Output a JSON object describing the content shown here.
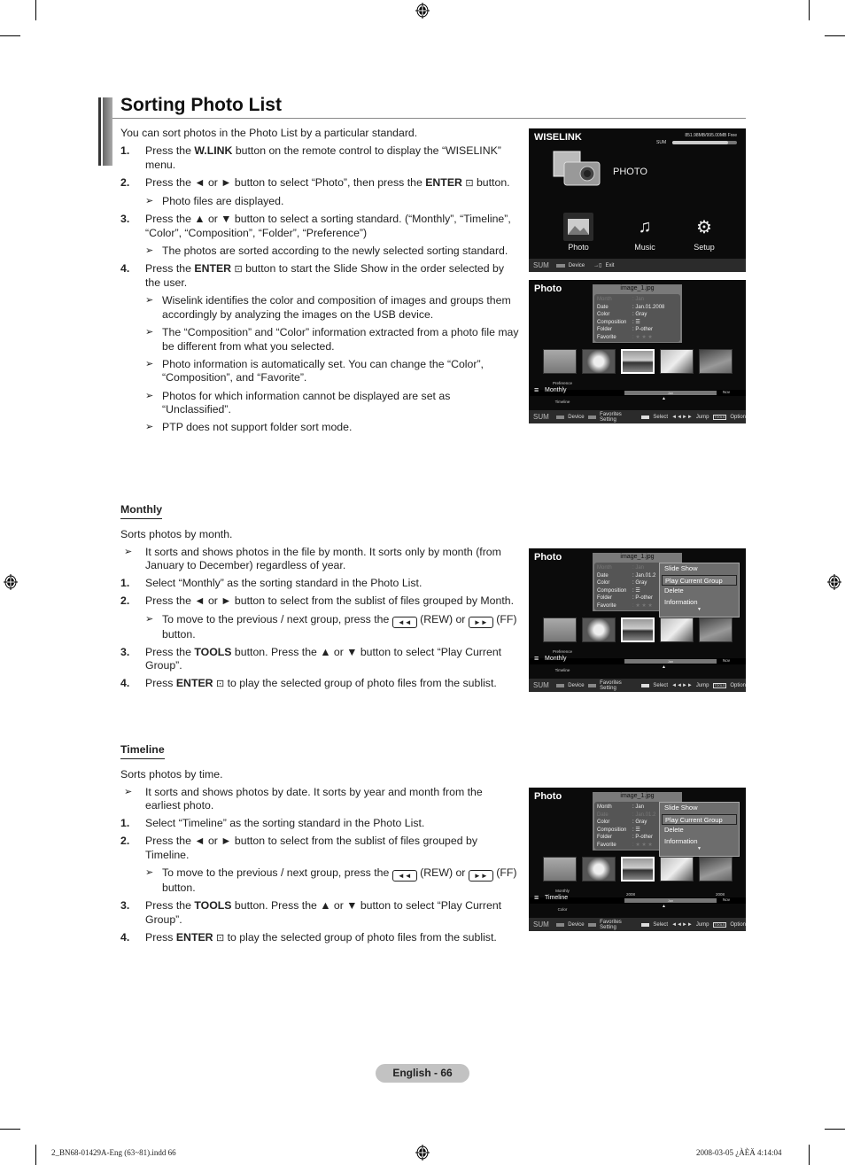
{
  "title": "Sorting Photo List",
  "intro": "You can sort photos in the Photo List by a particular standard.",
  "steps": [
    {
      "num": "1.",
      "pre": "Press the ",
      "bold": "W.LINK",
      "post": " button on the remote control to display the “WISELINK” menu."
    },
    {
      "num": "2.",
      "pre": "Press the ◄ or ► button to select “Photo”, then press the ",
      "bold": "ENTER",
      "post": " button."
    },
    {
      "num": "3.",
      "text": "Press the ▲ or ▼ button to select a sorting standard. (“Monthly”, “Timeline”, “Color”, “Composition”, “Folder”, “Preference”)"
    },
    {
      "num": "4.",
      "pre": "Press the ",
      "bold": "ENTER",
      "post": " button to start the Slide Show in the order selected by the user."
    }
  ],
  "notes": {
    "after2": "Photo files are displayed.",
    "after3": "The photos are sorted according to the newly selected sorting standard.",
    "after4": [
      "Wiselink identifies the color and composition of images and groups them accordingly by analyzing the images on the USB device.",
      "The “Composition” and “Color” information extracted from a photo file may be different from what you selected.",
      "Photo information is automatically set. You can change the “Color”, “Composition”, and “Favorite”.",
      "Photos for which information cannot be displayed are set as “Unclassified”.",
      "PTP does not support folder sort mode."
    ]
  },
  "enter_icon": "enter-icon",
  "arrow_glyph": "➢",
  "monthly": {
    "heading": "Monthly",
    "desc": "Sorts photos by month.",
    "note": "It sorts and shows photos in the file by month. It sorts only by month (from January to December) regardless of year.",
    "step1": "Select “Monthly” as the sorting standard in the Photo List.",
    "step2": "Press the ◄ or ► button to select from the sublist of files grouped by Month.",
    "step2_note_pre": "To move to the previous / next group, press the",
    "step2_note_rew": "(REW) or",
    "step2_note_ff": "(FF) button.",
    "step3_pre": "Press the ",
    "step3_bold": "TOOLS",
    "step3_post": " button. Press the ▲ or ▼ button to select “Play Current Group”.",
    "step4_pre": "Press ",
    "step4_bold": "ENTER",
    "step4_post": " to play the selected group of photo files from the sublist."
  },
  "timeline": {
    "heading": "Timeline",
    "desc": "Sorts photos by time.",
    "note": "It sorts and shows photos by date. It sorts by year and month from the earliest photo.",
    "step1": "Select “Timeline” as the sorting standard in the Photo List.",
    "step2": "Press the ◄ or ► button to select from the sublist of files grouped by Timeline.",
    "step2_note_pre": "To move to the previous / next group, press the",
    "step2_note_rew": "(REW) or",
    "step2_note_ff": "(FF) button.",
    "step3_pre": "Press the ",
    "step3_bold": "TOOLS",
    "step3_post": " button. Press the ▲ or ▼ button to select “Play Current Group”.",
    "step4_pre": "Press ",
    "step4_bold": "ENTER",
    "step4_post": " to play the selected group of photo files from the sublist."
  },
  "nums": {
    "n1": "1.",
    "n2": "2.",
    "n3": "3.",
    "n4": "4."
  },
  "buttons": {
    "rew": "◄◄",
    "ff": "►►"
  },
  "wiselink_screen": {
    "header": "WISELINK",
    "free": "851.98MB/995.00MB Free",
    "sum_label": "SUM",
    "storage_used_fraction": 0.86,
    "photo_label": "PHOTO",
    "apps": [
      {
        "label": "Photo",
        "icon": "photo-icon"
      },
      {
        "label": "Music",
        "icon": "music-note-icon"
      },
      {
        "label": "Setup",
        "icon": "gear-icon"
      }
    ],
    "bottom": {
      "sum": "SUM",
      "device": "Device",
      "exit": "Exit"
    }
  },
  "photo_screens": [
    {
      "header": "Photo",
      "filename": "image_1.jpg",
      "info": [
        {
          "k": "Month",
          "v": ": Jan",
          "dim": true
        },
        {
          "k": "Date",
          "v": ": Jan.01.2008"
        },
        {
          "k": "Color",
          "v": ": Gray"
        },
        {
          "k": "Composition",
          "v": ": ☰"
        },
        {
          "k": "Folder",
          "v": ": P-other"
        },
        {
          "k": "Favorite",
          "v": ": ★ ★ ★"
        }
      ],
      "sort_prev": "Preference",
      "sort_current": "Monthly",
      "sort_next": "Timeline",
      "track_label": "Jan",
      "track_end": "Nov"
    },
    {
      "header": "Photo",
      "filename": "image_1.jpg",
      "info": [
        {
          "k": "Month",
          "v": ": Jan",
          "dim": true
        },
        {
          "k": "Date",
          "v": ": Jan.01.2"
        },
        {
          "k": "Color",
          "v": ": Gray"
        },
        {
          "k": "Composition",
          "v": ": ☰"
        },
        {
          "k": "Folder",
          "v": ": P-other"
        },
        {
          "k": "Favorite",
          "v": ": ★ ★ ★"
        }
      ],
      "menu": [
        "Slide Show",
        "Play Current Group",
        "Delete",
        "Information"
      ],
      "menu_selected": 1,
      "sort_prev": "Preference",
      "sort_current": "Monthly",
      "sort_next": "Timeline",
      "track_label": "Jan",
      "track_end": "Nov"
    },
    {
      "header": "Photo",
      "filename": "image_1.jpg",
      "info": [
        {
          "k": "Month",
          "v": ": Jan"
        },
        {
          "k": "Date",
          "v": ": Jan.01.2",
          "dim": true
        },
        {
          "k": "Color",
          "v": ": Gray"
        },
        {
          "k": "Composition",
          "v": ": ☰"
        },
        {
          "k": "Folder",
          "v": ": P-other"
        },
        {
          "k": "Favorite",
          "v": ": ★ ★ ★"
        }
      ],
      "menu": [
        "Slide Show",
        "Play Current Group",
        "Delete",
        "Information"
      ],
      "menu_selected": 1,
      "sort_prev": "Monthly",
      "sort_current": "Timeline",
      "sort_next": "Color",
      "track_label": "Jan",
      "track_end": "Nov",
      "years": [
        "2008",
        "2008"
      ]
    }
  ],
  "photo_bottom": {
    "sum": "SUM",
    "device": "Device",
    "favorites": "Favorites Setting",
    "select": "Select",
    "jump": "Jump",
    "tools": "TOOLS",
    "option": "Option"
  },
  "page_label": "English - 66",
  "footer_left": "2_BN68-01429A-Eng (63~81).indd   66",
  "footer_right": "2008-03-05   ¿ÀÈÄ 4:14:04"
}
